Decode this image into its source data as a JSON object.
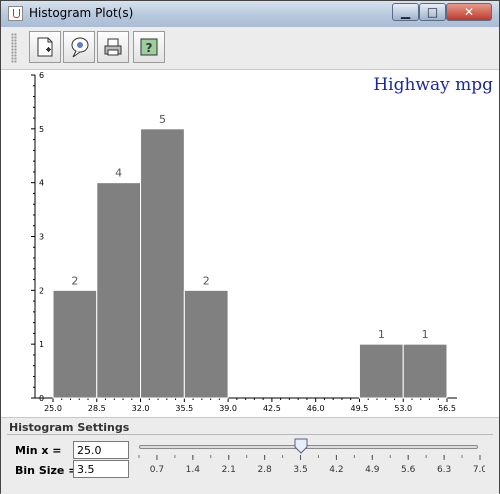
{
  "window": {
    "title": "Histogram Plot(s)"
  },
  "toolbar": {
    "buttons": [
      "new-document-icon",
      "info-balloon-icon",
      "printer-icon",
      "help-icon"
    ]
  },
  "chart_data": {
    "type": "bar",
    "title": "Highway mpg",
    "categories": [
      "25.0",
      "28.5",
      "32.0",
      "35.5",
      "39.0",
      "42.5",
      "46.0",
      "49.5",
      "53.0"
    ],
    "values": [
      2,
      4,
      5,
      2,
      0,
      0,
      0,
      1,
      1
    ],
    "bar_labels": [
      "2",
      "4",
      "5",
      "2",
      "",
      "",
      "",
      "1",
      "1"
    ],
    "bins": [
      [
        25.0,
        28.5
      ],
      [
        28.5,
        32.0
      ],
      [
        32.0,
        35.5
      ],
      [
        35.5,
        39.0
      ],
      [
        39.0,
        42.5
      ],
      [
        42.5,
        46.0
      ],
      [
        46.0,
        49.5
      ],
      [
        49.5,
        53.0
      ],
      [
        53.0,
        56.5
      ]
    ],
    "xticks": [
      "25.0",
      "28.5",
      "32.0",
      "35.5",
      "39.0",
      "42.5",
      "46.0",
      "49.5",
      "53.0",
      "56.5"
    ],
    "yticks": [
      "0",
      "1",
      "2",
      "3",
      "4",
      "5",
      "6"
    ],
    "xlim": [
      25.0,
      56.5
    ],
    "ylim": [
      0,
      6
    ],
    "bar_color": "#808080",
    "grid": false
  },
  "settings": {
    "title": "Histogram Settings",
    "min_x_label": "Min x =",
    "min_x_value": "25.0",
    "bin_size_label": "Bin Size =",
    "bin_size_value": "3.5",
    "slider": {
      "ticks": [
        "0.7",
        "1.4",
        "2.1",
        "2.8",
        "3.5",
        "4.2",
        "4.9",
        "5.6",
        "6.3",
        "7.0"
      ],
      "min": 0.35,
      "max": 7.0,
      "value": 3.5
    }
  },
  "colors": {
    "title": "#1a2a9a",
    "bars": "#808080",
    "close_button": "#c0392b"
  }
}
